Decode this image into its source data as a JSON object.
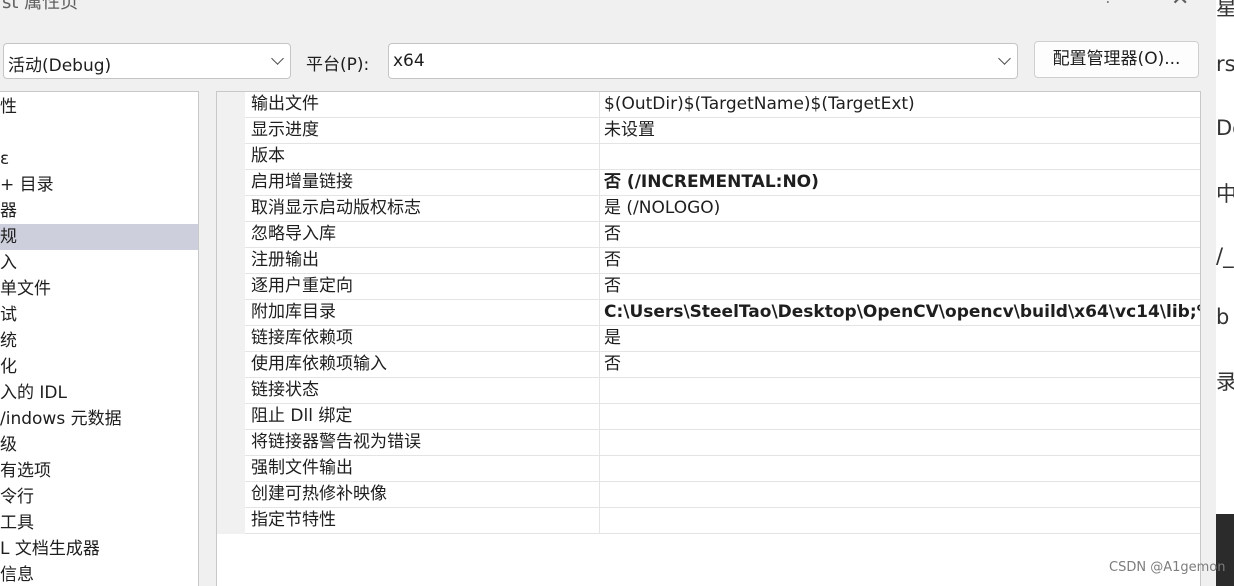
{
  "window": {
    "title": "st 属性页",
    "help_glyph": "?",
    "close_glyph": "✕"
  },
  "toolbar": {
    "config_value": "活动(Debug)",
    "platform_label": "平台(P):",
    "platform_value": "x64",
    "config_manager_label": "配置管理器(O)..."
  },
  "tree": {
    "items": [
      {
        "label": "性"
      },
      {
        "label": ""
      },
      {
        "label": "ε"
      },
      {
        "label": "+ 目录"
      },
      {
        "label": "器"
      },
      {
        "label": "规",
        "selected": true
      },
      {
        "label": "入"
      },
      {
        "label": "单文件"
      },
      {
        "label": "试"
      },
      {
        "label": "统"
      },
      {
        "label": "化"
      },
      {
        "label": "入的 IDL"
      },
      {
        "label": "/indows 元数据"
      },
      {
        "label": "级"
      },
      {
        "label": "有选项"
      },
      {
        "label": "令行"
      },
      {
        "label": "工具"
      },
      {
        "label": "L 文档生成器"
      },
      {
        "label": "信息"
      }
    ]
  },
  "properties": [
    {
      "name": "输出文件",
      "value": "$(OutDir)$(TargetName)$(TargetExt)",
      "bold": false
    },
    {
      "name": "显示进度",
      "value": "未设置",
      "bold": false
    },
    {
      "name": "版本",
      "value": "",
      "bold": false
    },
    {
      "name": "启用增量链接",
      "value": "否 (/INCREMENTAL:NO)",
      "bold": true
    },
    {
      "name": "取消显示启动版权标志",
      "value": "是 (/NOLOGO)",
      "bold": false
    },
    {
      "name": "忽略导入库",
      "value": "否",
      "bold": false
    },
    {
      "name": "注册输出",
      "value": "否",
      "bold": false
    },
    {
      "name": "逐用户重定向",
      "value": "否",
      "bold": false
    },
    {
      "name": "附加库目录",
      "value": "C:\\Users\\SteelTao\\Desktop\\OpenCV\\opencv\\build\\x64\\vc14\\lib;%(",
      "bold": true
    },
    {
      "name": "链接库依赖项",
      "value": "是",
      "bold": false
    },
    {
      "name": "使用库依赖项输入",
      "value": "否",
      "bold": false
    },
    {
      "name": "链接状态",
      "value": "",
      "bold": false
    },
    {
      "name": "阻止 Dll 绑定",
      "value": "",
      "bold": false
    },
    {
      "name": "将链接器警告视为错误",
      "value": "",
      "bold": false
    },
    {
      "name": "强制文件输出",
      "value": "",
      "bold": false
    },
    {
      "name": "创建可热修补映像",
      "value": "",
      "bold": false
    },
    {
      "name": "指定节特性",
      "value": "",
      "bold": false
    }
  ],
  "background_window": {
    "fragments": [
      "星",
      "rs",
      "De",
      "中",
      "/_",
      "b",
      "录"
    ]
  },
  "watermark": "CSDN @A1gemon"
}
